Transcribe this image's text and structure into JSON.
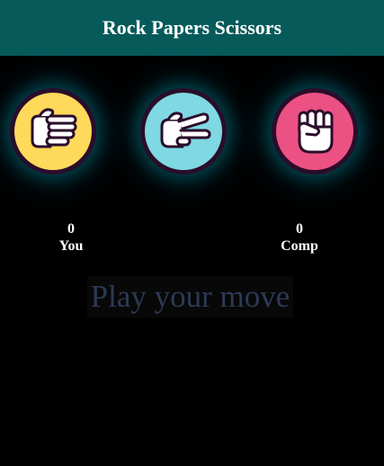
{
  "header": {
    "title": "Rock Papers Scissors"
  },
  "choices": [
    {
      "id": "paper",
      "icon": "hand-paper-icon",
      "color": "#ffd95a"
    },
    {
      "id": "scissors",
      "icon": "hand-scissors-icon",
      "color": "#7fd8e2"
    },
    {
      "id": "rock",
      "icon": "hand-rock-icon",
      "color": "#ec5184"
    }
  ],
  "scoreboard": {
    "user": {
      "score": "0",
      "label": "You"
    },
    "comp": {
      "score": "0",
      "label": "Comp"
    }
  },
  "message": {
    "text": "Play your move"
  },
  "colors": {
    "header_bg": "#075a5a",
    "page_bg": "#000000",
    "message_text": "#2c3a55"
  }
}
